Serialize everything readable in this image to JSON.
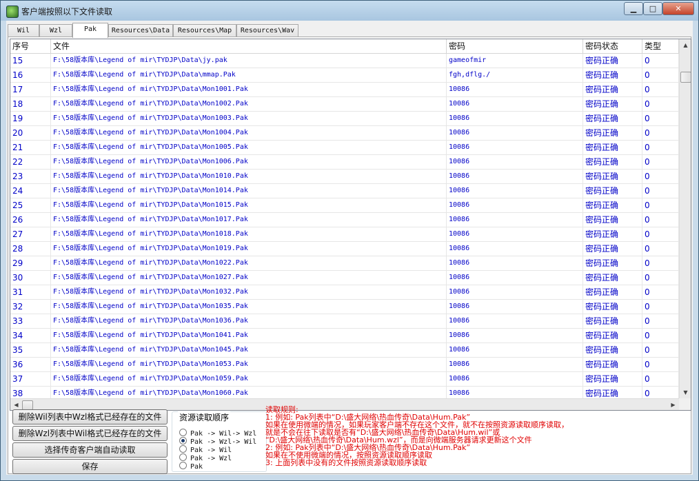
{
  "window": {
    "title": "客户端按照以下文件读取",
    "controls": {
      "minimize": "▁",
      "maximize": "□",
      "close": "✕"
    }
  },
  "tabs": [
    {
      "label": "Wil",
      "active": false
    },
    {
      "label": "Wzl",
      "active": false
    },
    {
      "label": "Pak",
      "active": true
    },
    {
      "label": "Resources\\Data",
      "active": false
    },
    {
      "label": "Resources\\Map",
      "active": false
    },
    {
      "label": "Resources\\Wav",
      "active": false
    }
  ],
  "grid": {
    "columns": [
      "序号",
      "文件",
      "密码",
      "密码状态",
      "类型"
    ],
    "rows": [
      {
        "no": "15",
        "file": "F:\\58版本库\\Legend of mir\\TYDJP\\Data\\jy.pak",
        "password": "gameofmir",
        "status": "密码正确",
        "type": "0"
      },
      {
        "no": "16",
        "file": "F:\\58版本库\\Legend of mir\\TYDJP\\Data\\mmap.Pak",
        "password": "fgh,dflg./",
        "status": "密码正确",
        "type": "0"
      },
      {
        "no": "17",
        "file": "F:\\58版本库\\Legend of mir\\TYDJP\\Data\\Mon1001.Pak",
        "password": "10086",
        "status": "密码正确",
        "type": "0"
      },
      {
        "no": "18",
        "file": "F:\\58版本库\\Legend of mir\\TYDJP\\Data\\Mon1002.Pak",
        "password": "10086",
        "status": "密码正确",
        "type": "0"
      },
      {
        "no": "19",
        "file": "F:\\58版本库\\Legend of mir\\TYDJP\\Data\\Mon1003.Pak",
        "password": "10086",
        "status": "密码正确",
        "type": "0"
      },
      {
        "no": "20",
        "file": "F:\\58版本库\\Legend of mir\\TYDJP\\Data\\Mon1004.Pak",
        "password": "10086",
        "status": "密码正确",
        "type": "0"
      },
      {
        "no": "21",
        "file": "F:\\58版本库\\Legend of mir\\TYDJP\\Data\\Mon1005.Pak",
        "password": "10086",
        "status": "密码正确",
        "type": "0"
      },
      {
        "no": "22",
        "file": "F:\\58版本库\\Legend of mir\\TYDJP\\Data\\Mon1006.Pak",
        "password": "10086",
        "status": "密码正确",
        "type": "0"
      },
      {
        "no": "23",
        "file": "F:\\58版本库\\Legend of mir\\TYDJP\\Data\\Mon1010.Pak",
        "password": "10086",
        "status": "密码正确",
        "type": "0"
      },
      {
        "no": "24",
        "file": "F:\\58版本库\\Legend of mir\\TYDJP\\Data\\Mon1014.Pak",
        "password": "10086",
        "status": "密码正确",
        "type": "0"
      },
      {
        "no": "25",
        "file": "F:\\58版本库\\Legend of mir\\TYDJP\\Data\\Mon1015.Pak",
        "password": "10086",
        "status": "密码正确",
        "type": "0"
      },
      {
        "no": "26",
        "file": "F:\\58版本库\\Legend of mir\\TYDJP\\Data\\Mon1017.Pak",
        "password": "10086",
        "status": "密码正确",
        "type": "0"
      },
      {
        "no": "27",
        "file": "F:\\58版本库\\Legend of mir\\TYDJP\\Data\\Mon1018.Pak",
        "password": "10086",
        "status": "密码正确",
        "type": "0"
      },
      {
        "no": "28",
        "file": "F:\\58版本库\\Legend of mir\\TYDJP\\Data\\Mon1019.Pak",
        "password": "10086",
        "status": "密码正确",
        "type": "0"
      },
      {
        "no": "29",
        "file": "F:\\58版本库\\Legend of mir\\TYDJP\\Data\\Mon1022.Pak",
        "password": "10086",
        "status": "密码正确",
        "type": "0"
      },
      {
        "no": "30",
        "file": "F:\\58版本库\\Legend of mir\\TYDJP\\Data\\Mon1027.Pak",
        "password": "10086",
        "status": "密码正确",
        "type": "0"
      },
      {
        "no": "31",
        "file": "F:\\58版本库\\Legend of mir\\TYDJP\\Data\\Mon1032.Pak",
        "password": "10086",
        "status": "密码正确",
        "type": "0"
      },
      {
        "no": "32",
        "file": "F:\\58版本库\\Legend of mir\\TYDJP\\Data\\Mon1035.Pak",
        "password": "10086",
        "status": "密码正确",
        "type": "0"
      },
      {
        "no": "33",
        "file": "F:\\58版本库\\Legend of mir\\TYDJP\\Data\\Mon1036.Pak",
        "password": "10086",
        "status": "密码正确",
        "type": "0"
      },
      {
        "no": "34",
        "file": "F:\\58版本库\\Legend of mir\\TYDJP\\Data\\Mon1041.Pak",
        "password": "10086",
        "status": "密码正确",
        "type": "0"
      },
      {
        "no": "35",
        "file": "F:\\58版本库\\Legend of mir\\TYDJP\\Data\\Mon1045.Pak",
        "password": "10086",
        "status": "密码正确",
        "type": "0"
      },
      {
        "no": "36",
        "file": "F:\\58版本库\\Legend of mir\\TYDJP\\Data\\Mon1053.Pak",
        "password": "10086",
        "status": "密码正确",
        "type": "0"
      },
      {
        "no": "37",
        "file": "F:\\58版本库\\Legend of mir\\TYDJP\\Data\\Mon1059.Pak",
        "password": "10086",
        "status": "密码正确",
        "type": "0"
      },
      {
        "no": "38",
        "file": "F:\\58版本库\\Legend of mir\\TYDJP\\Data\\Mon1060.Pak",
        "password": "10086",
        "status": "密码正确",
        "type": "0"
      }
    ]
  },
  "buttons": {
    "delete_wil": "删除Wil列表中Wzl格式已经存在的文件",
    "delete_wzl": "删除Wzl列表中Wil格式已经存在的文件",
    "select_client": "选择传奇客户端自动读取",
    "save": "保存"
  },
  "load_order": {
    "title": "资源读取顺序",
    "options": [
      {
        "label": "Pak -> Wil-> Wzl",
        "checked": false
      },
      {
        "label": "Pak -> Wzl-> Wil",
        "checked": true
      },
      {
        "label": "Pak -> Wil",
        "checked": false
      },
      {
        "label": "Pak -> Wzl",
        "checked": false
      },
      {
        "label": "Pak",
        "checked": false
      }
    ]
  },
  "rules": [
    "读取规则:",
    "1: 例如: Pak列表中“D:\\盛大网络\\热血传奇\\Data\\Hum.Pak”",
    "    如果在使用微端的情况，如果玩家客户端不存在这个文件，就不在按照资源读取顺序读取，",
    "    就是不会在往下读取是否有“D:\\盛大网络\\热血传奇\\Data\\Hum.wil”或",
    "“D:\\盛大网络\\热血传奇\\Data\\Hum.wzl”，而是向微端服务器请求更新这个文件",
    "2: 例如: Pak列表中“D:\\盛大网络\\热血传奇\\Data\\Hum.Pak”",
    "    如果在不使用微端的情况，按照资源读取顺序读取",
    "3: 上面列表中没有的文件按照资源读取顺序读取"
  ],
  "colors": {
    "link_blue": "#0000c8",
    "rule_red": "#e00000"
  }
}
